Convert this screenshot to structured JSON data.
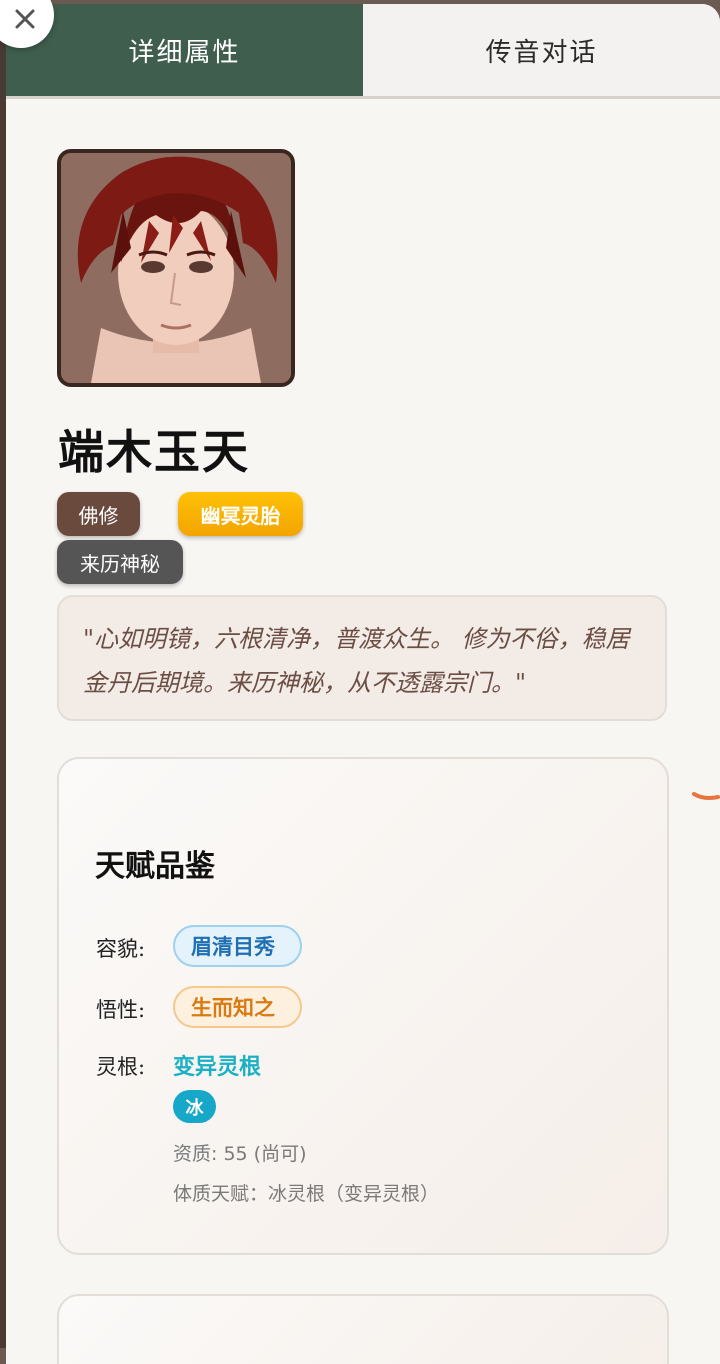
{
  "tabs": {
    "details": "详细属性",
    "chat": "传音对话"
  },
  "character": {
    "name": "端木玉天",
    "tags": {
      "sect": "佛修",
      "spirit_root": "幽冥灵胎",
      "origin": "来历神秘"
    },
    "quote": "\"心如明镜，六根清净，普渡众生。 修为不俗，稳居金丹后期境。来历神秘，从不透露宗门。\""
  },
  "talent": {
    "title": "天赋品鉴",
    "appearance_label": "容貌:",
    "appearance_value": "眉清目秀",
    "comprehension_label": "悟性:",
    "comprehension_value": "生而知之",
    "root_label": "灵根:",
    "root_value": "变异灵根",
    "element": "冰",
    "aptitude": "资质: 55 (尚可)",
    "constitution": "体质天赋：冰灵根（变异灵根）"
  },
  "colors": {
    "active_tab": "#3f5e4e",
    "root_tag": "#ffc107",
    "sect_tag": "#6b4a3e",
    "element_badge": "#17a7c8"
  },
  "icons": {
    "close": "close-icon"
  }
}
